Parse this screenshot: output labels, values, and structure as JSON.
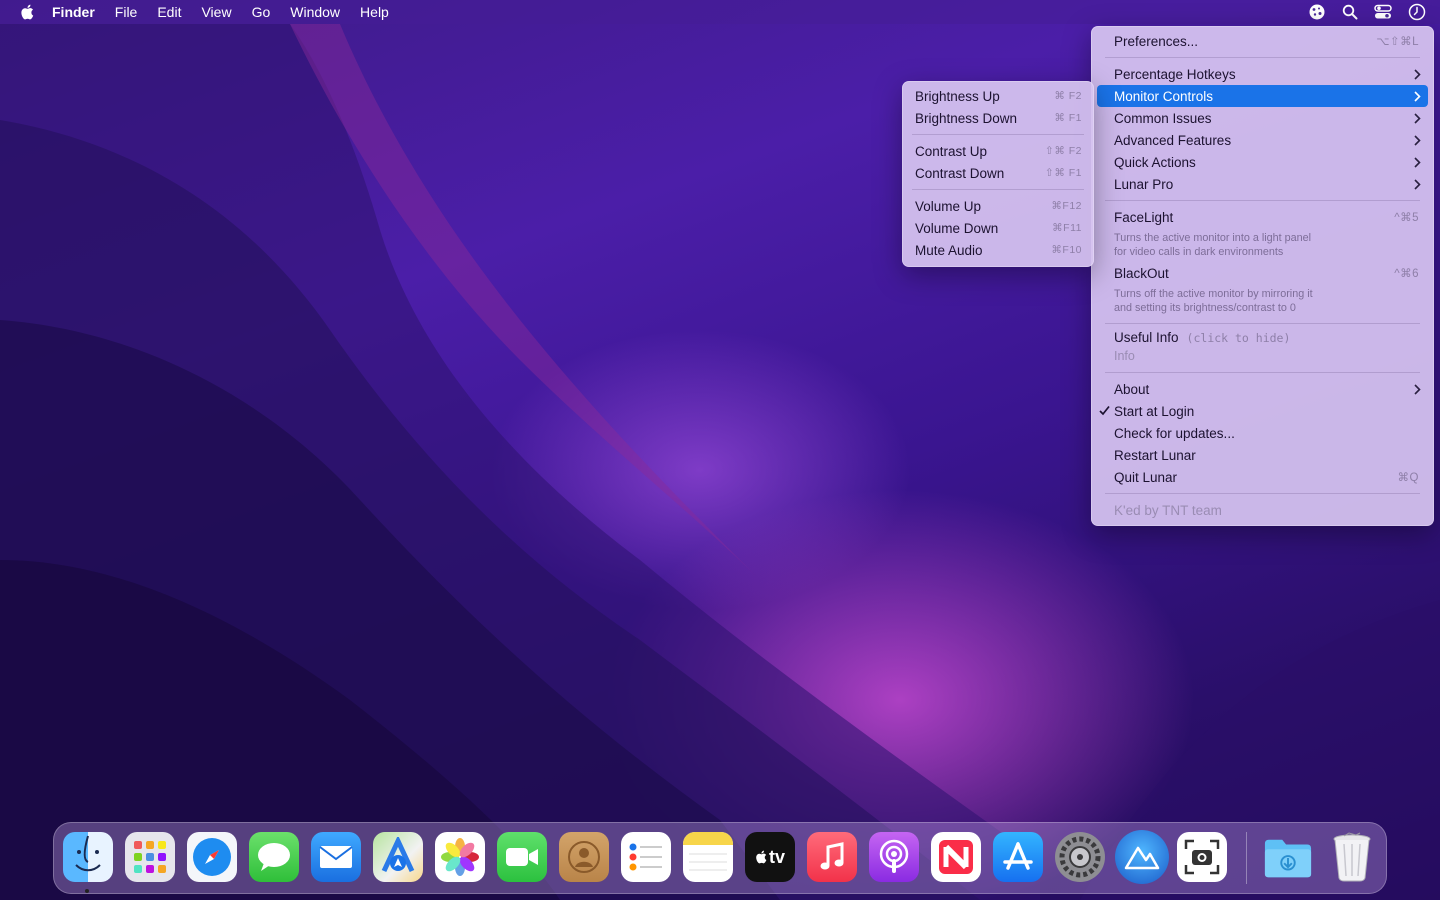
{
  "menubar": {
    "app_name": "Finder",
    "menus": [
      "File",
      "Edit",
      "View",
      "Go",
      "Window",
      "Help"
    ],
    "status_icons": [
      "lunar-icon",
      "search-icon",
      "control-center-icon",
      "clock-icon"
    ]
  },
  "main_menu": {
    "preferences": {
      "label": "Preferences...",
      "shortcut": "⌥⇧⌘L"
    },
    "percentage_hotkeys": "Percentage Hotkeys",
    "monitor_controls": "Monitor Controls",
    "common_issues": "Common Issues",
    "advanced_features": "Advanced Features",
    "quick_actions": "Quick Actions",
    "lunar_pro": "Lunar Pro",
    "facelight": {
      "label": "FaceLight",
      "shortcut": "^⌘5",
      "desc1": "Turns the active monitor into a light panel",
      "desc2": "for video calls in dark environments"
    },
    "blackout": {
      "label": "BlackOut",
      "shortcut": "^⌘6",
      "desc1": "Turns off the active monitor by mirroring it",
      "desc2": "and setting its brightness/contrast to 0"
    },
    "useful_info": {
      "label": "Useful Info",
      "hint": "(click to hide)",
      "sub": "Info"
    },
    "about": "About",
    "start_at_login": "Start at Login",
    "check_updates": "Check for updates...",
    "restart": "Restart Lunar",
    "quit": {
      "label": "Quit Lunar",
      "shortcut": "⌘Q"
    },
    "footer": "K'ed by TNT team"
  },
  "sub_menu": {
    "brightness_up": {
      "label": "Brightness Up",
      "shortcut": "⌘ F2"
    },
    "brightness_down": {
      "label": "Brightness Down",
      "shortcut": "⌘ F1"
    },
    "contrast_up": {
      "label": "Contrast Up",
      "shortcut": "⇧⌘ F2"
    },
    "contrast_down": {
      "label": "Contrast Down",
      "shortcut": "⇧⌘ F1"
    },
    "volume_up": {
      "label": "Volume Up",
      "shortcut": "⌘F12"
    },
    "volume_down": {
      "label": "Volume Down",
      "shortcut": "⌘F11"
    },
    "mute_audio": {
      "label": "Mute Audio",
      "shortcut": "⌘F10"
    }
  },
  "dock": {
    "apps": [
      "Finder",
      "Launchpad",
      "Safari",
      "Messages",
      "Mail",
      "Maps",
      "Photos",
      "FaceTime",
      "Contacts",
      "Reminders",
      "Notes",
      "TV",
      "Music",
      "Podcasts",
      "News",
      "App Store",
      "System Preferences",
      "Lunar",
      "Screenshot",
      "Downloads",
      "Trash"
    ],
    "tv_label": "tv"
  },
  "colors": {
    "highlight": "#1a73e8",
    "menu_bg": "#d6c4f0"
  }
}
